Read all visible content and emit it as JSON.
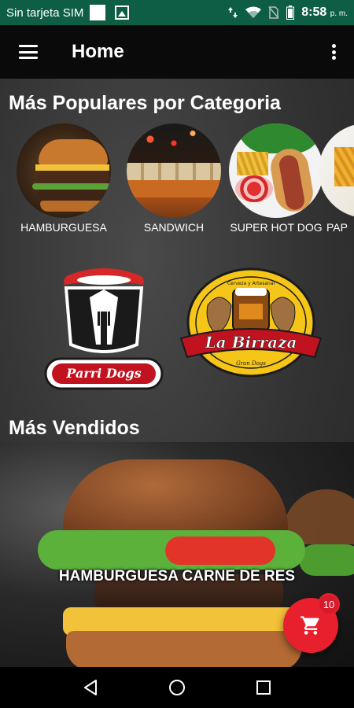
{
  "status_bar": {
    "carrier": "Sin tarjeta SIM",
    "time": "8:58",
    "ampm": "p. m.",
    "icons": [
      "square-notification-icon",
      "image-notification-icon",
      "data-arrows-icon",
      "wifi-icon",
      "no-sim-icon",
      "battery-icon"
    ]
  },
  "app_bar": {
    "title": "Home",
    "icons": [
      "menu-icon",
      "more-vert-icon"
    ]
  },
  "popular": {
    "title": "Más Populares por Categoria",
    "categories": [
      {
        "label": "HAMBURGUESA"
      },
      {
        "label": "SANDWICH"
      },
      {
        "label": "SUPER HOT DOG"
      },
      {
        "label": "PAP"
      }
    ]
  },
  "brands": {
    "parri": {
      "logo_text": "Parri Dogs"
    },
    "birraza": {
      "logo_text": "La Birraza",
      "tagline": "Cerveza y Artesanal",
      "small": "Gran Dogs"
    }
  },
  "best_sellers": {
    "title": "Más Vendidos",
    "item_name": "HAMBURGUESA CARNE DE RES"
  },
  "cart": {
    "icon": "shopping-cart-icon",
    "badge_count": "10",
    "color": "#e8202e"
  },
  "nav_bar": {
    "icons": [
      "back-icon",
      "home-icon",
      "recents-icon"
    ]
  },
  "colors": {
    "status_bar": "#0e5e45",
    "app_bar": "#0a0a0a",
    "accent": "#e8202e"
  }
}
